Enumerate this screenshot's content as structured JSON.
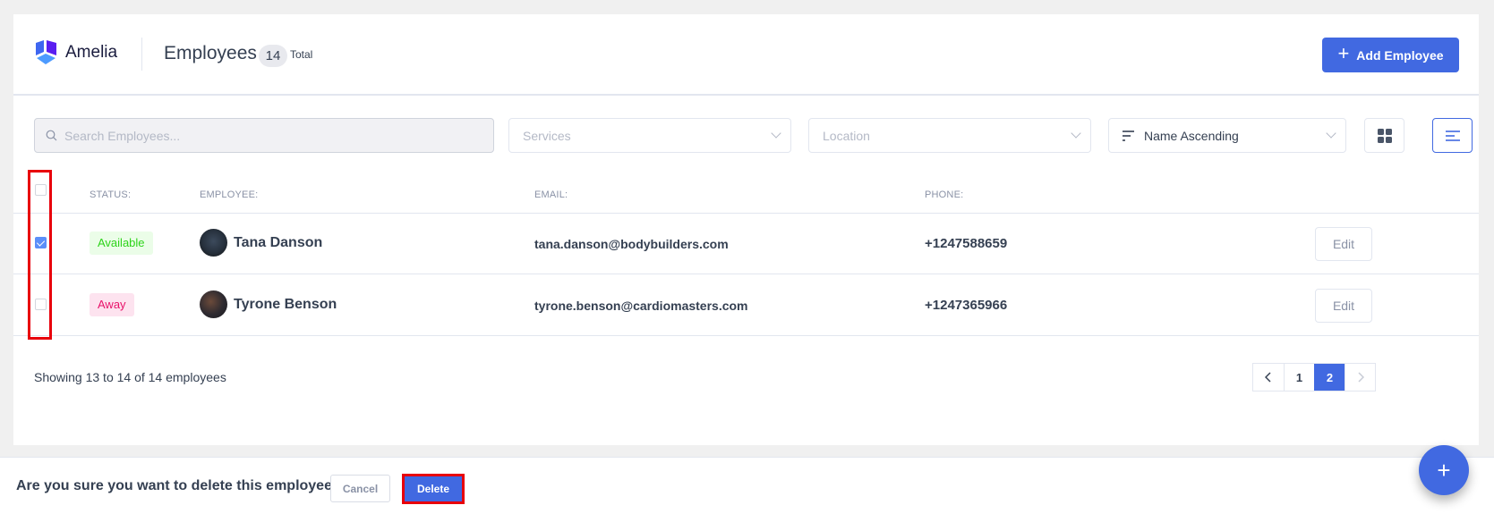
{
  "app": {
    "brand": "Amelia",
    "colors": {
      "accent": "#4169e1",
      "available": "#2ed41a",
      "away": "#e8136a"
    }
  },
  "header": {
    "title": "Employees",
    "count": "14",
    "count_suffix": "Total",
    "add_button_label": "Add Employee",
    "add_button_icon": "plus-icon"
  },
  "filters": {
    "search": {
      "placeholder": "Search Employees...",
      "value": "",
      "icon": "search-icon"
    },
    "services": {
      "placeholder": "Services"
    },
    "location": {
      "placeholder": "Location"
    },
    "sort": {
      "selected": "Name Ascending",
      "icon": "sort-icon"
    },
    "views": [
      {
        "name": "grid-view",
        "icon": "grid-icon",
        "active": false
      },
      {
        "name": "list-view",
        "icon": "list-icon",
        "active": true
      }
    ]
  },
  "table": {
    "columns": [
      "STATUS:",
      "EMPLOYEE:",
      "EMAIL:",
      "PHONE:"
    ],
    "select_all_checked": false,
    "rows": [
      {
        "checked": true,
        "status": "Available",
        "name": "Tana Danson",
        "email": "tana.danson@bodybuilders.com",
        "phone": "+1247588659",
        "action": "Edit"
      },
      {
        "checked": false,
        "status": "Away",
        "name": "Tyrone Benson",
        "email": "tyrone.benson@cardiomasters.com",
        "phone": "+1247365966",
        "action": "Edit"
      }
    ]
  },
  "pagination": {
    "summary": "Showing 13 to 14 of 14 employees",
    "pages": [
      "1",
      "2"
    ],
    "current_page": "2",
    "prev_icon": "chevron-left-icon",
    "next_icon": "chevron-right-icon"
  },
  "confirm_bar": {
    "question": "Are you sure you want to delete this employee?",
    "cancel_label": "Cancel",
    "delete_label": "Delete"
  },
  "fab": {
    "icon": "plus-icon",
    "label": "+"
  }
}
